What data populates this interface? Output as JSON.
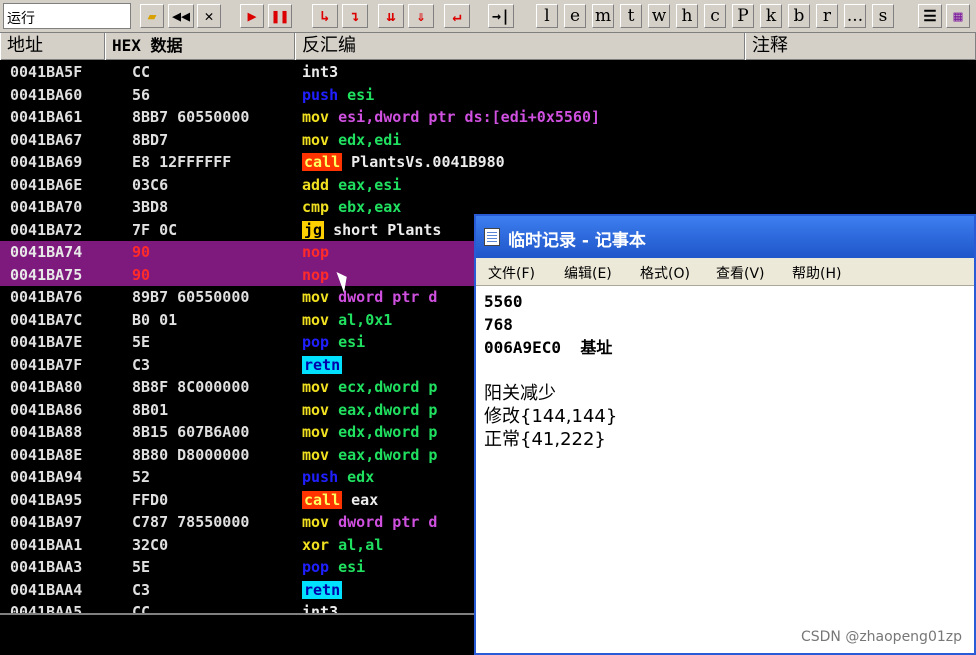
{
  "toolbar": {
    "status": "运行",
    "letters": [
      "l",
      "e",
      "m",
      "t",
      "w",
      "h",
      "c",
      "P",
      "k",
      "b",
      "r",
      "...",
      "s"
    ]
  },
  "columns": {
    "address": "地址",
    "hex": "HEX 数据",
    "disasm": "反汇编",
    "comment": "注释"
  },
  "rows": [
    {
      "addr": "0041BA5F",
      "hex": "CC",
      "mnem": "int3",
      "ops": ""
    },
    {
      "addr": "0041BA60",
      "hex": "56",
      "mnem": "push",
      "ops": "esi"
    },
    {
      "addr": "0041BA61",
      "hex": "8BB7 60550000",
      "mnem": "mov",
      "ops": "esi,dword ptr ds:[edi+0x5560]"
    },
    {
      "addr": "0041BA67",
      "hex": "8BD7",
      "mnem": "mov",
      "ops": "edx,edi"
    },
    {
      "addr": "0041BA69",
      "hex": "E8 12FFFFFF",
      "mnem": "call",
      "ops": "PlantsVs.0041B980"
    },
    {
      "addr": "0041BA6E",
      "hex": "03C6",
      "mnem": "add",
      "ops": "eax,esi"
    },
    {
      "addr": "0041BA70",
      "hex": "3BD8",
      "mnem": "cmp",
      "ops": "ebx,eax"
    },
    {
      "addr": "0041BA72",
      "hex": "7F 0C",
      "mnem": "jg",
      "ops": "short Plants"
    },
    {
      "addr": "0041BA74",
      "hex": "90",
      "mnem": "nop",
      "ops": ""
    },
    {
      "addr": "0041BA75",
      "hex": "90",
      "mnem": "nop",
      "ops": ""
    },
    {
      "addr": "0041BA76",
      "hex": "89B7 60550000",
      "mnem": "mov",
      "ops": "dword ptr d"
    },
    {
      "addr": "0041BA7C",
      "hex": "B0 01",
      "mnem": "mov",
      "ops": "al,0x1"
    },
    {
      "addr": "0041BA7E",
      "hex": "5E",
      "mnem": "pop",
      "ops": "esi"
    },
    {
      "addr": "0041BA7F",
      "hex": "C3",
      "mnem": "retn",
      "ops": ""
    },
    {
      "addr": "0041BA80",
      "hex": "8B8F 8C000000",
      "mnem": "mov",
      "ops": "ecx,dword p"
    },
    {
      "addr": "0041BA86",
      "hex": "8B01",
      "mnem": "mov",
      "ops": "eax,dword p"
    },
    {
      "addr": "0041BA88",
      "hex": "8B15 607B6A00",
      "mnem": "mov",
      "ops": "edx,dword p"
    },
    {
      "addr": "0041BA8E",
      "hex": "8B80 D8000000",
      "mnem": "mov",
      "ops": "eax,dword p"
    },
    {
      "addr": "0041BA94",
      "hex": "52",
      "mnem": "push",
      "ops": "edx"
    },
    {
      "addr": "0041BA95",
      "hex": "FFD0",
      "mnem": "call",
      "ops": "eax"
    },
    {
      "addr": "0041BA97",
      "hex": "C787 78550000",
      "mnem": "mov",
      "ops": "dword ptr d"
    },
    {
      "addr": "0041BAA1",
      "hex": "32C0",
      "mnem": "xor",
      "ops": "al,al"
    },
    {
      "addr": "0041BAA3",
      "hex": "5E",
      "mnem": "pop",
      "ops": "esi"
    },
    {
      "addr": "0041BAA4",
      "hex": "C3",
      "mnem": "retn",
      "ops": ""
    },
    {
      "addr": "0041BAA5",
      "hex": "CC",
      "mnem": "int3",
      "ops": ""
    }
  ],
  "notepad": {
    "title": "临时记录 - 记事本",
    "menu": [
      "文件(F)",
      "编辑(E)",
      "格式(O)",
      "查看(V)",
      "帮助(H)"
    ],
    "lines": [
      "5560",
      "768",
      "006A9EC0  基址",
      "",
      "阳关减少",
      "修改{144,144}",
      "正常{41,222}"
    ]
  },
  "watermark": "CSDN @zhaopeng01zp"
}
